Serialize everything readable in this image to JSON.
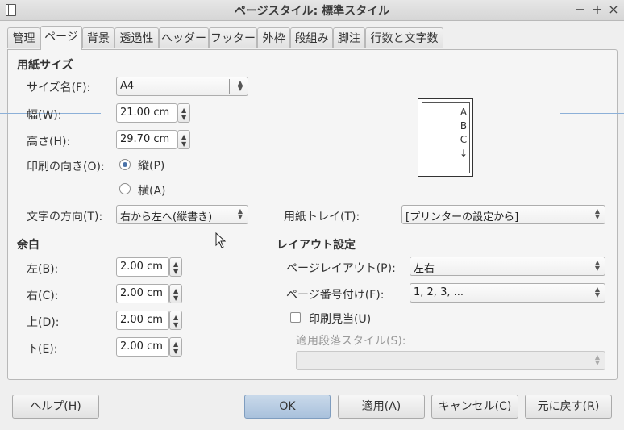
{
  "window": {
    "title": "ページスタイル: 標準スタイル",
    "minimize": "−",
    "maximize": "+",
    "close": "×"
  },
  "tabs": [
    "管理",
    "ページ",
    "背景",
    "透過性",
    "ヘッダー",
    "フッター",
    "外枠",
    "段組み",
    "脚注",
    "行数と文字数"
  ],
  "active_tab": "ページ",
  "paper": {
    "heading": "用紙サイズ",
    "size_label": "サイズ名(F):",
    "size_value": "A4",
    "width_label": "幅(W):",
    "width_value": "21.00 cm",
    "height_label": "高さ(H):",
    "height_value": "29.70 cm",
    "orientation_label": "印刷の向き(O):",
    "portrait_label": "縦(P)",
    "landscape_label": "横(A)",
    "orientation_selected": "portrait",
    "text_direction_label": "文字の方向(T):",
    "text_direction_value": "右から左へ(縦書き)",
    "tray_label": "用紙トレイ(T):",
    "tray_value": "[プリンターの設定から]"
  },
  "preview": {
    "letters": [
      "A",
      "B",
      "C"
    ],
    "arrow": "↓"
  },
  "margins": {
    "heading": "余白",
    "left_label": "左(B):",
    "left_value": "2.00 cm",
    "right_label": "右(C):",
    "right_value": "2.00 cm",
    "top_label": "上(D):",
    "top_value": "2.00 cm",
    "bottom_label": "下(E):",
    "bottom_value": "2.00 cm"
  },
  "layout": {
    "heading": "レイアウト設定",
    "page_layout_label": "ページレイアウト(P):",
    "page_layout_value": "左右",
    "numbering_label": "ページ番号付け(F):",
    "numbering_value": "1, 2, 3, ...",
    "register_label": "印刷見当(U)",
    "register_checked": false,
    "para_style_label": "適用段落スタイル(S):",
    "para_style_value": ""
  },
  "buttons": {
    "help": "ヘルプ(H)",
    "ok": "OK",
    "apply": "適用(A)",
    "cancel": "キャンセル(C)",
    "reset": "元に戻す(R)"
  },
  "icons": {
    "window": "window-icon",
    "mouse_pointer": "mouse-pointer-icon"
  }
}
